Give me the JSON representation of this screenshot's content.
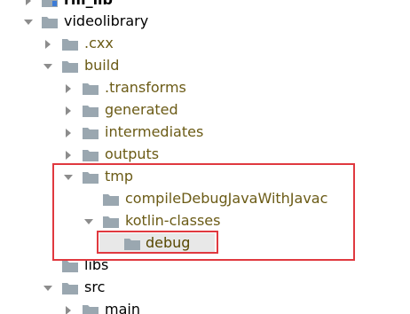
{
  "tree": {
    "rows": [
      {
        "label": "rm_lib",
        "expanded": false,
        "type": "module-folder",
        "color": "#000000"
      },
      {
        "label": "videolibrary",
        "expanded": true,
        "type": "folder",
        "color": "#000000"
      },
      {
        "label": ".cxx",
        "expanded": false,
        "type": "folder",
        "color": "#6b5b16"
      },
      {
        "label": "build",
        "expanded": true,
        "type": "folder",
        "color": "#6b5b16"
      },
      {
        "label": ".transforms",
        "expanded": false,
        "type": "folder",
        "color": "#6b5b16"
      },
      {
        "label": "generated",
        "expanded": false,
        "type": "folder",
        "color": "#6b5b16"
      },
      {
        "label": "intermediates",
        "expanded": false,
        "type": "folder",
        "color": "#6b5b16"
      },
      {
        "label": "outputs",
        "expanded": false,
        "type": "folder",
        "color": "#6b5b16"
      },
      {
        "label": "tmp",
        "expanded": true,
        "type": "folder",
        "color": "#6b5b16"
      },
      {
        "label": "compileDebugJavaWithJavac",
        "expanded": null,
        "type": "folder",
        "color": "#6b5b16"
      },
      {
        "label": "kotlin-classes",
        "expanded": true,
        "type": "folder",
        "color": "#6b5b16"
      },
      {
        "label": "debug",
        "expanded": null,
        "type": "folder",
        "color": "#574700",
        "selected": true
      },
      {
        "label": "libs",
        "expanded": null,
        "type": "folder",
        "color": "#000000"
      },
      {
        "label": "src",
        "expanded": true,
        "type": "folder",
        "color": "#000000"
      },
      {
        "label": "main",
        "expanded": false,
        "type": "folder",
        "color": "#000000"
      }
    ]
  },
  "colors": {
    "folder_fill": "#9aa7b0",
    "arrow": "#8c8c8c",
    "highlight_border": "#e0393f",
    "selection_bg": "#e8e8e8"
  }
}
